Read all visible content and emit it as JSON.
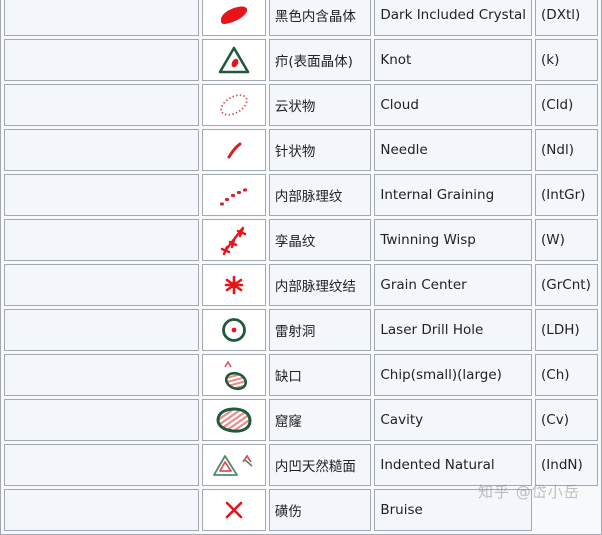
{
  "colors": {
    "red": "#e8141b",
    "green": "#1e5b3a",
    "pink": "#e88a8a",
    "border": "#a2a9b1",
    "cell_bg": "#f3f6fb"
  },
  "rows": [
    {
      "icon": "dark-included-crystal-icon",
      "zh": "黑色内含晶体",
      "en": "Dark Included Crystal",
      "abbr": "(DXtl)"
    },
    {
      "icon": "knot-icon",
      "zh": "疖(表面晶体)",
      "en": "Knot",
      "abbr": "(k)"
    },
    {
      "icon": "cloud-icon",
      "zh": "云状物",
      "en": "Cloud",
      "abbr": "(Cld)"
    },
    {
      "icon": "needle-icon",
      "zh": "针状物",
      "en": "Needle",
      "abbr": "(Ndl)"
    },
    {
      "icon": "internal-graining-icon",
      "zh": "内部脉理纹",
      "en": "Internal Graining",
      "abbr": "(IntGr)"
    },
    {
      "icon": "twinning-wisp-icon",
      "zh": "孪晶纹",
      "en": "Twinning Wisp",
      "abbr": "(W)"
    },
    {
      "icon": "grain-center-icon",
      "zh": "内部脉理纹结",
      "en": "Grain Center",
      "abbr": "(GrCnt)"
    },
    {
      "icon": "laser-drill-hole-icon",
      "zh": "雷射洞",
      "en": "Laser Drill Hole",
      "abbr": "(LDH)"
    },
    {
      "icon": "chip-icon",
      "zh": "缺口",
      "en": "Chip(small)(large)",
      "abbr": "(Ch)"
    },
    {
      "icon": "cavity-icon",
      "zh": "窟窿",
      "en": "Cavity",
      "abbr": "(Cv)"
    },
    {
      "icon": "indented-natural-icon",
      "zh": "内凹天然糙面",
      "en": "Indented Natural",
      "abbr": "(IndN)"
    },
    {
      "icon": "bruise-icon",
      "zh": "磺伤",
      "en": "Bruise",
      "abbr": ""
    }
  ],
  "watermark": "知乎 @岱小岳"
}
